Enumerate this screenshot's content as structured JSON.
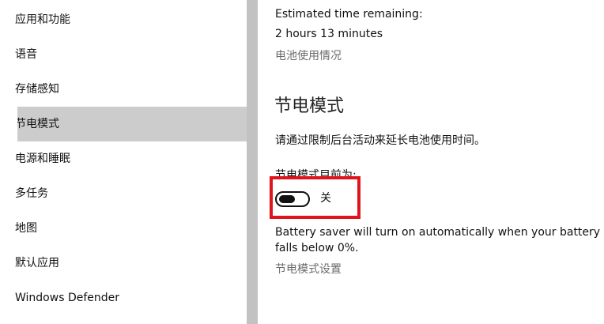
{
  "sidebar": {
    "items": [
      {
        "label": "应用和功能"
      },
      {
        "label": "语音"
      },
      {
        "label": "存储感知"
      },
      {
        "label": "节电模式",
        "selected": true
      },
      {
        "label": "电源和睡眠"
      },
      {
        "label": "多任务"
      },
      {
        "label": "地图"
      },
      {
        "label": "默认应用"
      },
      {
        "label": "Windows Defender"
      }
    ]
  },
  "main": {
    "estimated_label": "Estimated time remaining:",
    "estimated_value": "2 hours 13 minutes",
    "battery_usage_link": "电池使用情况",
    "section_title": "节电模式",
    "section_desc": "请通过限制后台活动来延长电池使用时间。",
    "status_label": "节电模式目前为:",
    "toggle_state": "关",
    "auto_desc": "Battery saver will turn on automatically when your battery falls below 0%.",
    "settings_link": "节电模式设置"
  },
  "colors": {
    "selected_bg": "#cccccc",
    "highlight": "#e0141c",
    "link": "#6b6b6b"
  }
}
